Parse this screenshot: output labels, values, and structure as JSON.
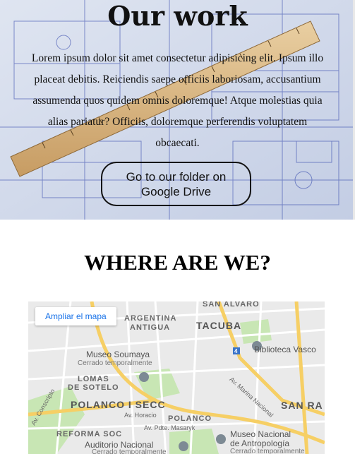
{
  "hero": {
    "title": "Our work",
    "text": "Lorem ipsum dolor sit amet consectetur adipisicing elit. Ipsum illo placeat debitis. Reiciendis saepe officiis laboriosam, accusantium assumenda quos quidem omnis doloremque! Atque molestias quia alias pariatur? Officiis, doloremque perferendis voluptatem obcaecati.",
    "button_label": "Go to our folder on Google Drive"
  },
  "location": {
    "title": "WHERE ARE WE?"
  },
  "map": {
    "enlarge_link": "Ampliar el mapa",
    "labels": {
      "san_alvaro": "SAN ALVARO",
      "argentina_antigua_1": "ARGENTINA",
      "argentina_antigua_2": "ANTIGUA",
      "tacuba": "TACUBA",
      "museo_soumaya": "Museo Soumaya",
      "cerrado_1": "Cerrado temporalmente",
      "biblioteca": "Biblioteca Vasco",
      "lomas_1": "LOMAS",
      "lomas_2": "DE SOTELO",
      "polanco_i": "POLANCO I SECC",
      "san_ra": "SAN RA",
      "av_horacio": "Av. Horacio",
      "polanco": "POLANCO",
      "av_masaryk": "Av. Pdte. Masaryk",
      "reforma": "REFORMA SOC",
      "auditorio": "Auditorio Nacional",
      "cerrado_2": "Cerrado temporalmente",
      "museo_antro_1": "Museo Nacional",
      "museo_antro_2": "de Antropología",
      "cerrado_3": "Cerrado temporalmente",
      "av_marina": "Av. Marina Nacional",
      "av_conscripto": "Av. Conscripto",
      "highway_4": "4"
    }
  },
  "colors": {
    "hero_bg": "#cfd8ea",
    "blueprint_line": "#2a3fa8",
    "map_bg": "#eaeaea",
    "road_yellow": "#f6cf65",
    "park_green": "#c8e6b4",
    "link_blue": "#1a73e8"
  }
}
